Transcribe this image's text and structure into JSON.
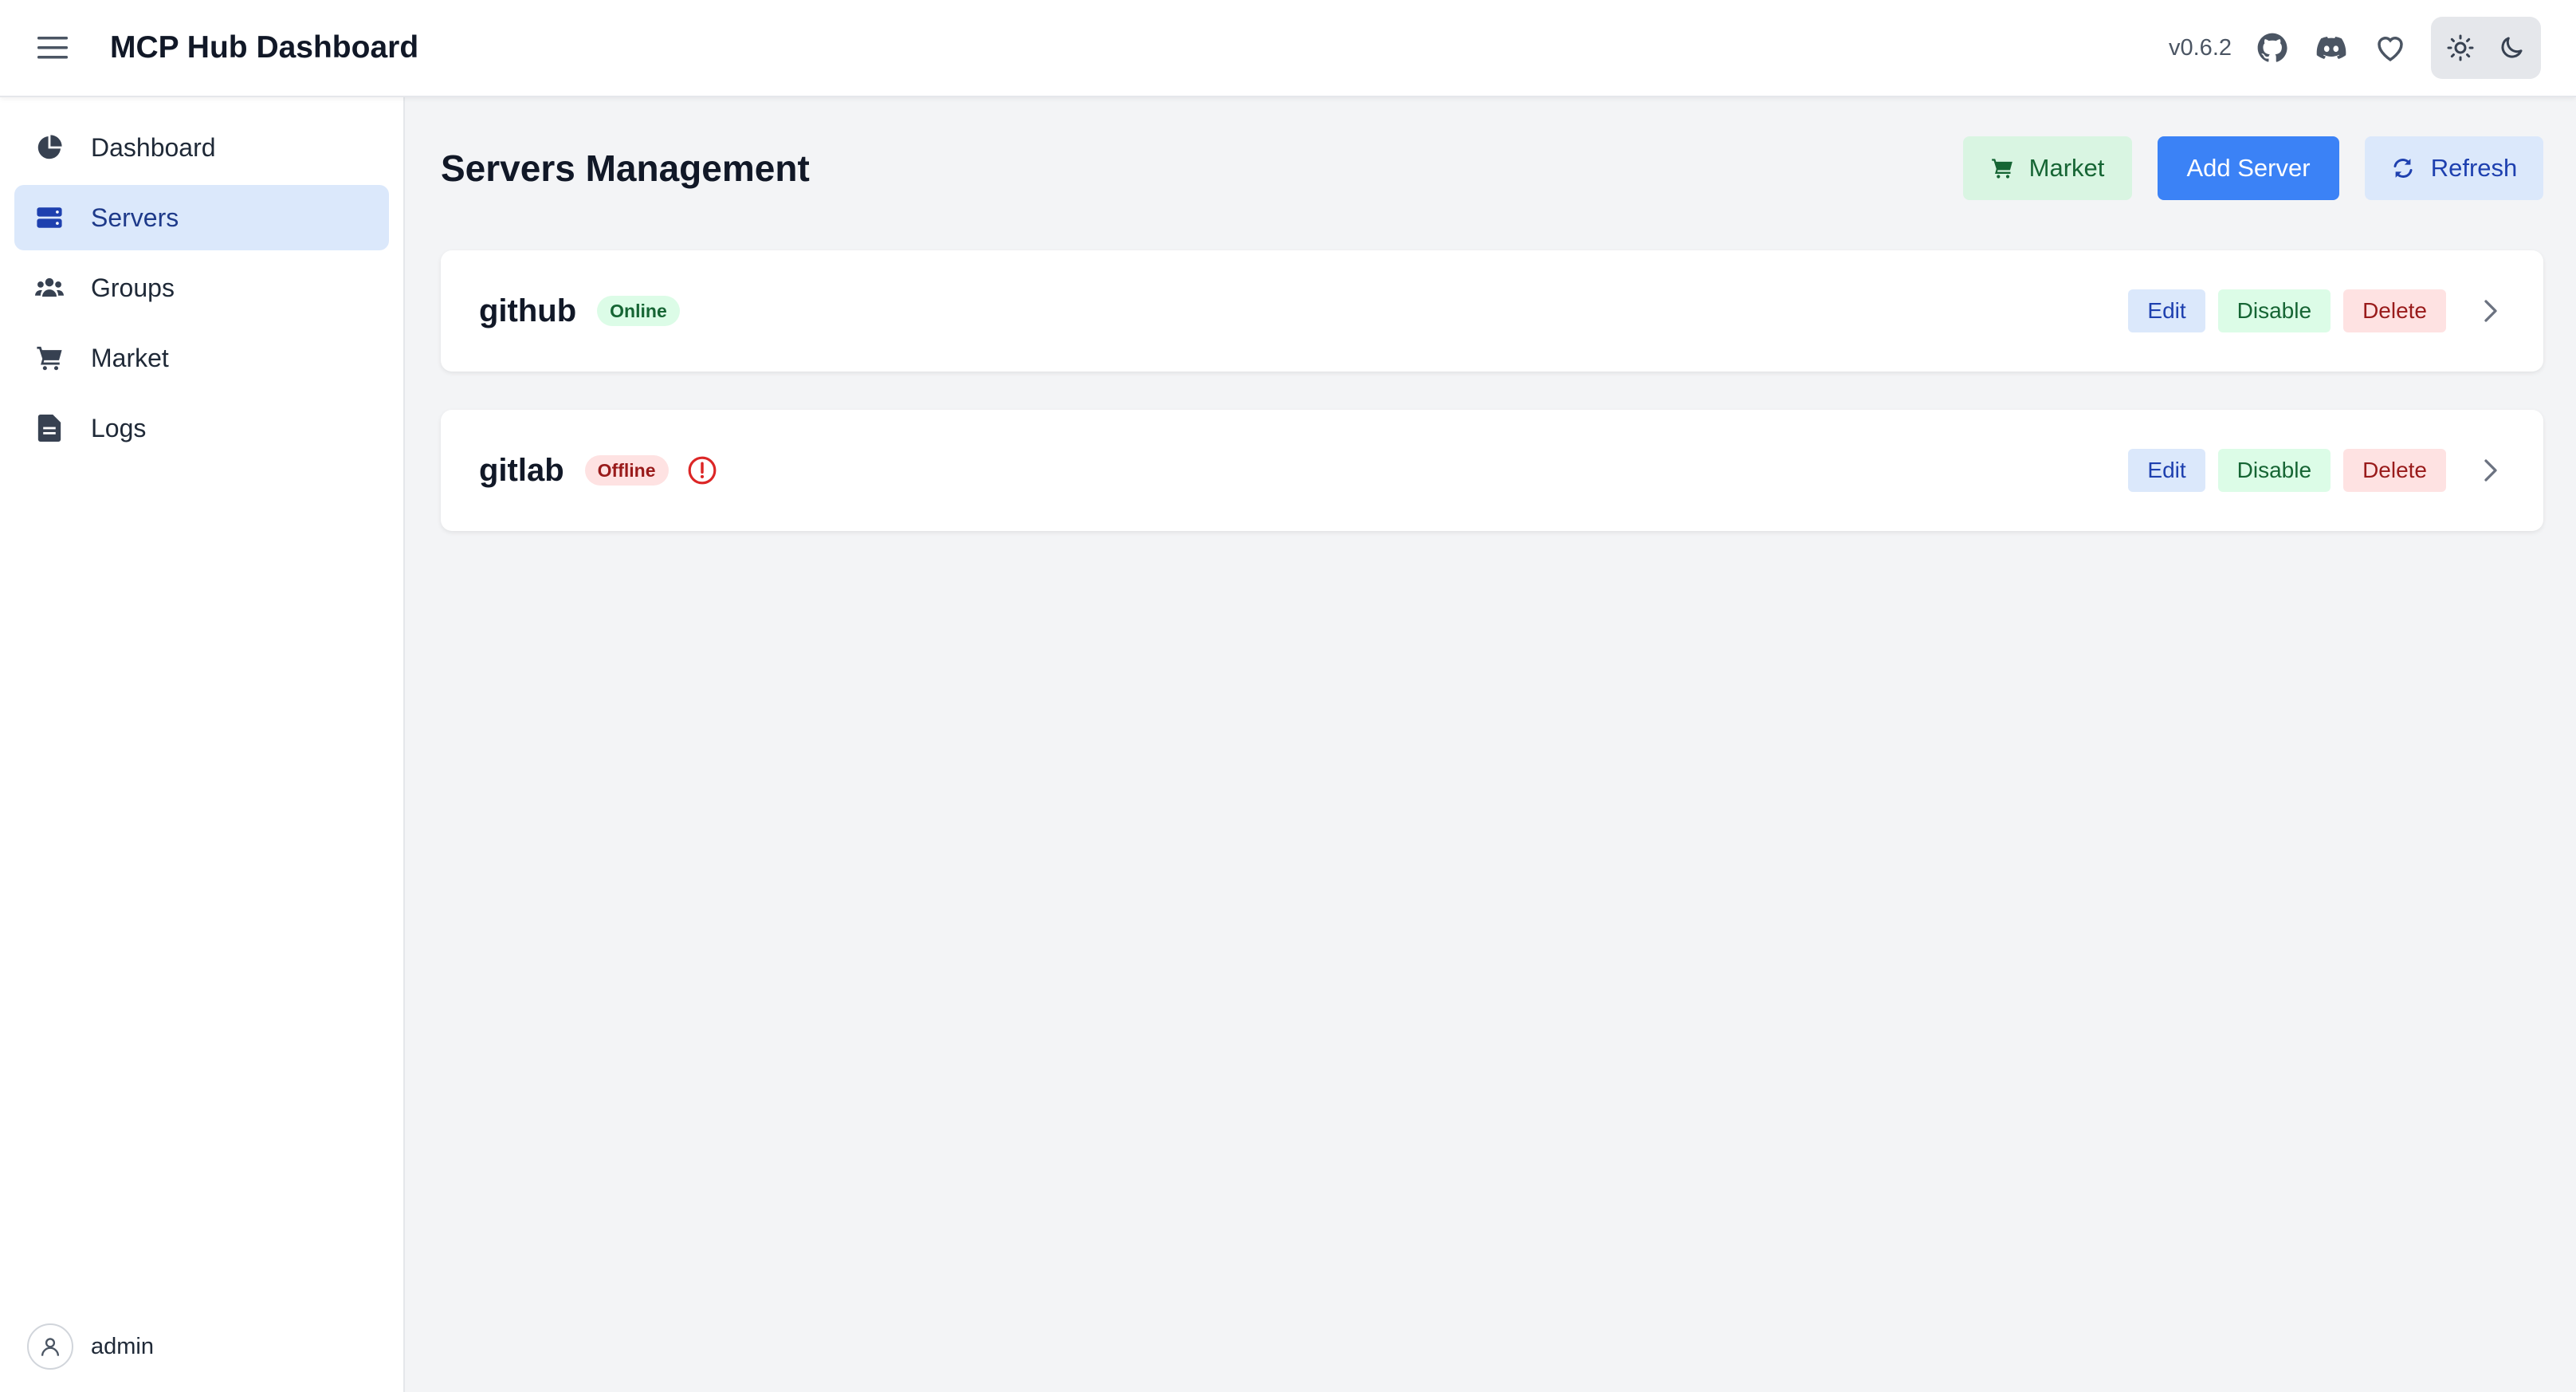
{
  "header": {
    "title": "MCP Hub Dashboard",
    "version": "v0.6.2",
    "icons": [
      "menu-icon",
      "github-icon",
      "discord-icon",
      "heart-icon",
      "sun-icon",
      "moon-icon"
    ]
  },
  "sidebar": {
    "items": [
      {
        "label": "Dashboard",
        "icon": "pie-chart-icon",
        "active": false
      },
      {
        "label": "Servers",
        "icon": "server-icon",
        "active": true
      },
      {
        "label": "Groups",
        "icon": "users-icon",
        "active": false
      },
      {
        "label": "Market",
        "icon": "cart-icon",
        "active": false
      },
      {
        "label": "Logs",
        "icon": "document-icon",
        "active": false
      }
    ],
    "user": {
      "name": "admin"
    }
  },
  "main": {
    "title": "Servers Management",
    "buttons": {
      "market": "Market",
      "add_server": "Add Server",
      "refresh": "Refresh"
    },
    "servers": [
      {
        "name": "github",
        "status": "Online",
        "edit": "Edit",
        "disable": "Disable",
        "delete": "Delete"
      },
      {
        "name": "gitlab",
        "status": "Offline",
        "edit": "Edit",
        "disable": "Disable",
        "delete": "Delete"
      }
    ]
  },
  "colors": {
    "primary": "#3b82f6",
    "active_nav_bg": "#dbe8fb",
    "online_bg": "#dcfce7",
    "online_text": "#166534",
    "offline_bg": "#fee2e2",
    "offline_text": "#991b1b"
  }
}
